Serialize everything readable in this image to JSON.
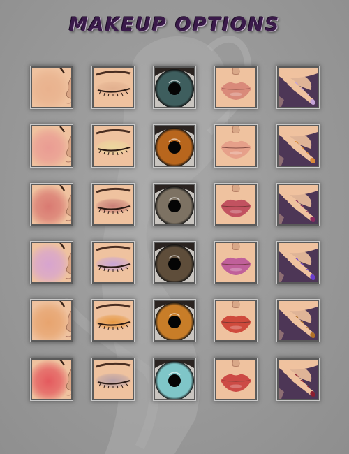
{
  "title": "MAKEUP OPTIONS",
  "colors": {
    "background": "#9c9c9c",
    "title": "#3a1a4a",
    "skin": "#efc29f",
    "nail_background": "#4d3656"
  },
  "categories": [
    "blush",
    "eyeshadow",
    "iris",
    "lips",
    "nails"
  ],
  "rows": [
    {
      "blush": "#e9b28e",
      "eyeshadow": "#e2b08f",
      "iris": "#3e5e5e",
      "lips": "#d98a7a",
      "nails": "#c4a3d8"
    },
    {
      "blush": "#ea9c93",
      "eyeshadow": "#ecd89e",
      "iris": "#b8661d",
      "lips": "#e6a08a",
      "nails": "#d98a3a"
    },
    {
      "blush": "#d97a72",
      "eyeshadow": "#c98078",
      "iris": "#7d7263",
      "lips": "#c25260",
      "nails": "#8a2a5e"
    },
    {
      "blush": "#d7a4cf",
      "eyeshadow": "#c9a6d6",
      "iris": "#5e4d3a",
      "lips": "#c0609a",
      "nails": "#6b3fcf"
    },
    {
      "blush": "#e7a46f",
      "eyeshadow": "#e79a45",
      "iris": "#c87d28",
      "lips": "#cf4a3c",
      "nails": "#b07028"
    },
    {
      "blush": "#e45a5e",
      "eyeshadow": "#b8a0a6",
      "iris": "#7fc6c8",
      "lips": "#cc4a45",
      "nails": "#8a1e30"
    }
  ]
}
